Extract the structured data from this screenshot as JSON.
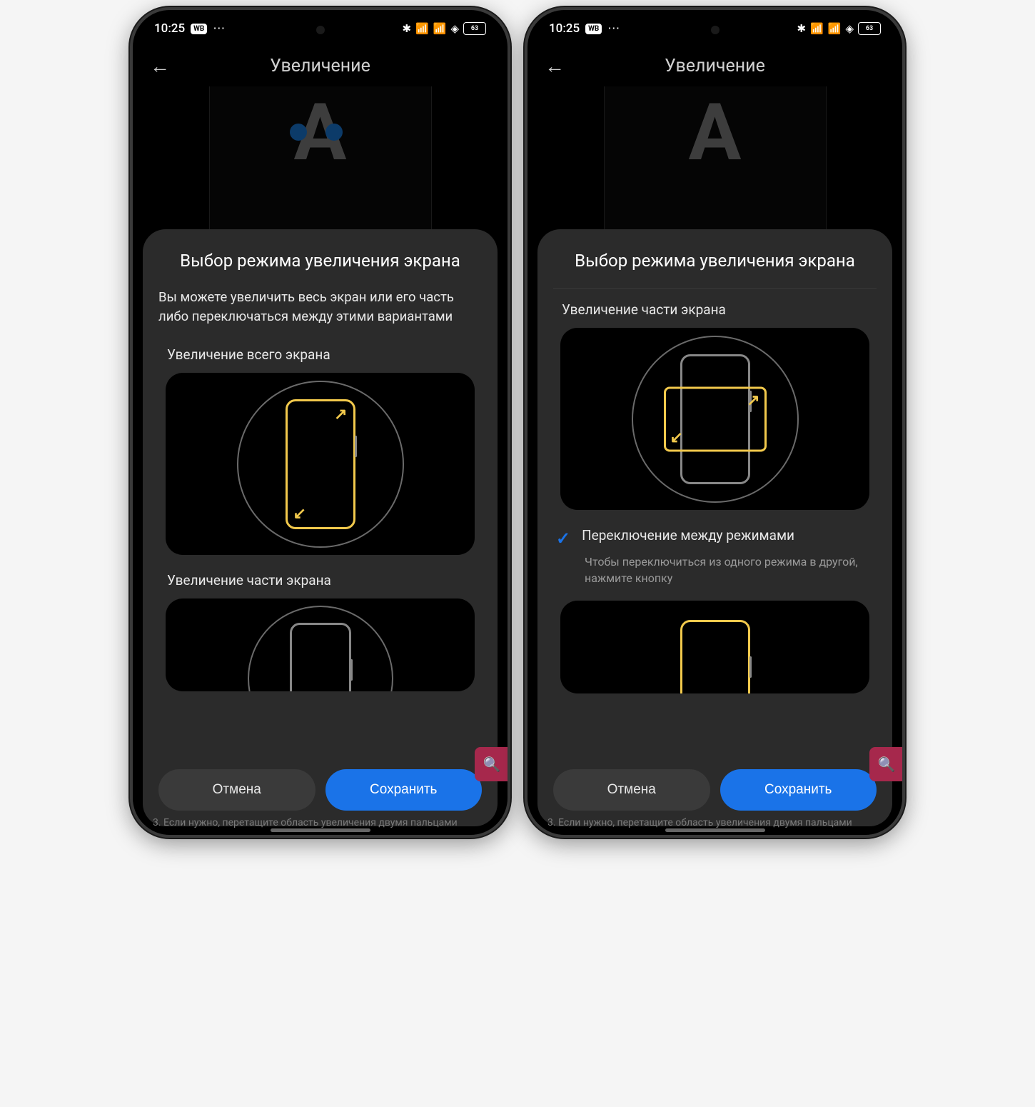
{
  "status": {
    "time": "10:25",
    "wb": "WB",
    "battery": "63"
  },
  "header": {
    "title": "Увеличение"
  },
  "modal": {
    "title": "Выбор режима увеличения экрана",
    "intro": "Вы можете увеличить весь экран или его часть либо переключаться между этими вариантами",
    "option_full": "Увеличение всего экрана",
    "option_part": "Увеличение части экрана",
    "switch_label": "Переключение между режимами",
    "switch_desc": "Чтобы переключиться из одного режима в другой, нажмите кнопку",
    "cancel": "Отмена",
    "save": "Сохранить"
  },
  "hint": "3. Если нужно, перетащите область увеличения двумя пальцами"
}
